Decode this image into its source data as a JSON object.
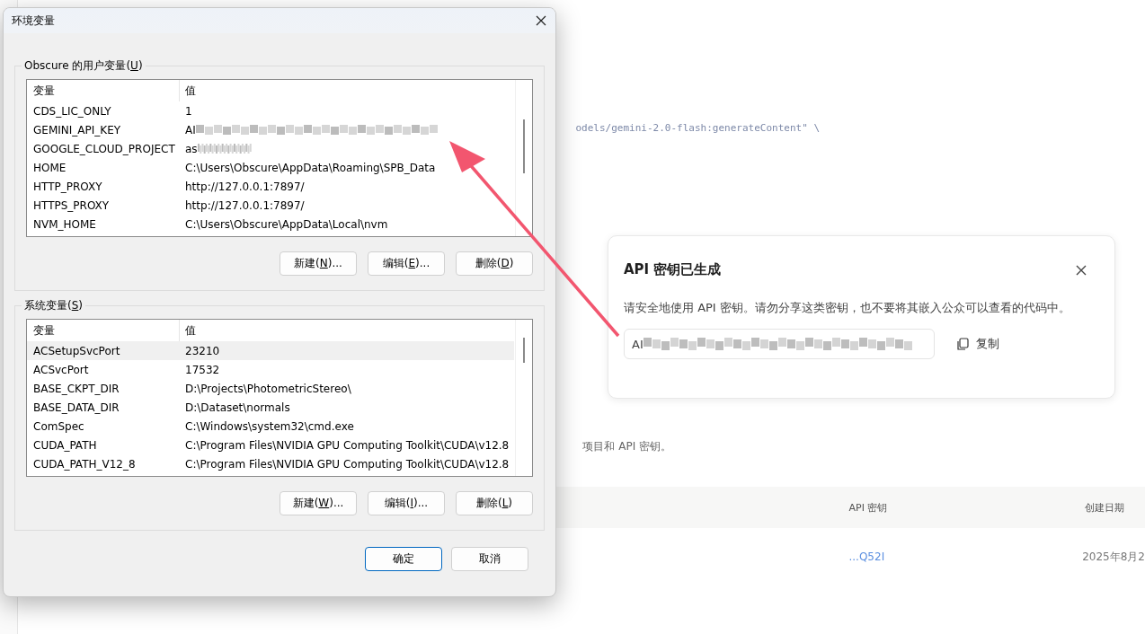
{
  "page": {
    "code_line": "odels/gemini-2.0-flash:generateContent\" \\",
    "note": "项目和 API 密钥。",
    "table": {
      "columns": [
        "API 密钥",
        "创建日期"
      ],
      "rows": [
        {
          "key": "...Q52I",
          "date": "2025年8月2"
        }
      ]
    }
  },
  "dialog": {
    "title": "环境变量",
    "user_group": {
      "label_before": "Obscure 的用户变量(",
      "mnemonic": "U",
      "label_after": ")",
      "columns": [
        "变量",
        "值"
      ],
      "rows": [
        {
          "name": "CDS_LIC_ONLY",
          "value": "1",
          "redacted": false,
          "selected": false
        },
        {
          "name": "GEMINI_API_KEY",
          "value": "AI",
          "redacted": true,
          "selected": false
        },
        {
          "name": "GOOGLE_CLOUD_PROJECT",
          "value": "as",
          "redacted": true,
          "selected": false
        },
        {
          "name": "HOME",
          "value": "C:\\Users\\Obscure\\AppData\\Roaming\\SPB_Data",
          "redacted": false,
          "selected": false
        },
        {
          "name": "HTTP_PROXY",
          "value": "http://127.0.0.1:7897/",
          "redacted": false,
          "selected": false
        },
        {
          "name": "HTTPS_PROXY",
          "value": "http://127.0.0.1:7897/",
          "redacted": false,
          "selected": false
        },
        {
          "name": "NVM_HOME",
          "value": "C:\\Users\\Obscure\\AppData\\Local\\nvm",
          "redacted": false,
          "selected": false
        }
      ],
      "buttons": [
        {
          "before": "新建(",
          "mnemonic": "N",
          "after": ")..."
        },
        {
          "before": "编辑(",
          "mnemonic": "E",
          "after": ")..."
        },
        {
          "before": "删除(",
          "mnemonic": "D",
          "after": ")"
        }
      ]
    },
    "system_group": {
      "label_before": "系统变量(",
      "mnemonic": "S",
      "label_after": ")",
      "columns": [
        "变量",
        "值"
      ],
      "rows": [
        {
          "name": "ACSetupSvcPort",
          "value": "23210",
          "redacted": false,
          "selected": true
        },
        {
          "name": "ACSvcPort",
          "value": "17532",
          "redacted": false,
          "selected": false
        },
        {
          "name": "BASE_CKPT_DIR",
          "value": "D:\\Projects\\PhotometricStereo\\",
          "redacted": false,
          "selected": false
        },
        {
          "name": "BASE_DATA_DIR",
          "value": "D:\\Dataset\\normals",
          "redacted": false,
          "selected": false
        },
        {
          "name": "ComSpec",
          "value": "C:\\Windows\\system32\\cmd.exe",
          "redacted": false,
          "selected": false
        },
        {
          "name": "CUDA_PATH",
          "value": "C:\\Program Files\\NVIDIA GPU Computing Toolkit\\CUDA\\v12.8",
          "redacted": false,
          "selected": false
        },
        {
          "name": "CUDA_PATH_V12_8",
          "value": "C:\\Program Files\\NVIDIA GPU Computing Toolkit\\CUDA\\v12.8",
          "redacted": false,
          "selected": false
        }
      ],
      "buttons": [
        {
          "before": "新建(",
          "mnemonic": "W",
          "after": ")..."
        },
        {
          "before": "编辑(",
          "mnemonic": "I",
          "after": ")..."
        },
        {
          "before": "删除(",
          "mnemonic": "L",
          "after": ")"
        }
      ]
    },
    "footer_buttons": [
      {
        "label": "确定",
        "default": true
      },
      {
        "label": "取消",
        "default": false
      }
    ]
  },
  "api_card": {
    "title": "API 密钥已生成",
    "description": "请安全地使用 API 密钥。请勿分享这类密钥，也不要将其嵌入公众可以查看的代码中。",
    "key_value": "AI",
    "key_redacted": true,
    "copy_label": "复制"
  }
}
